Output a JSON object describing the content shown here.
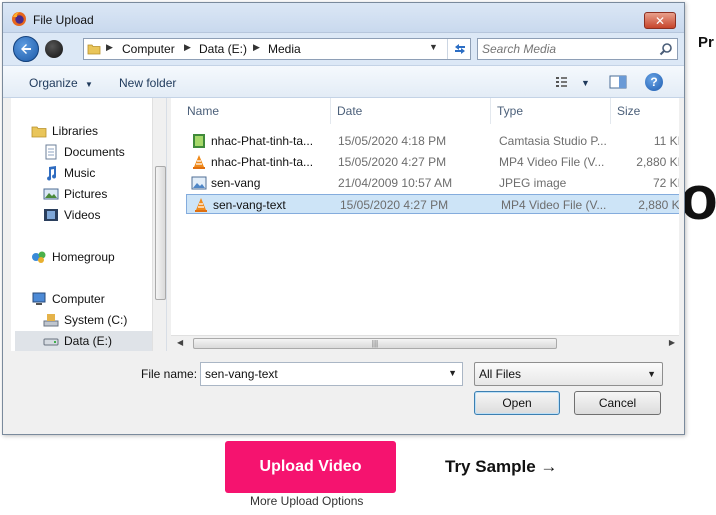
{
  "page": {
    "heading_fragment": "Pr",
    "big_text_fragment": "o",
    "upload_button": "Upload Video",
    "try_sample": "Try Sample →",
    "more_options": "More Upload Options"
  },
  "dialog": {
    "title": "File Upload",
    "close_label": "✕",
    "address": {
      "crumbs": [
        "Computer",
        "Data (E:)",
        "Media"
      ]
    },
    "search": {
      "placeholder": "Search Media"
    },
    "toolbar": {
      "organize": "Organize",
      "new_folder": "New folder",
      "help": "?"
    },
    "nav": {
      "items": [
        {
          "label": "Libraries",
          "icon": "libraries-icon"
        },
        {
          "label": "Documents",
          "icon": "documents-icon"
        },
        {
          "label": "Music",
          "icon": "music-icon"
        },
        {
          "label": "Pictures",
          "icon": "pictures-icon"
        },
        {
          "label": "Videos",
          "icon": "videos-icon"
        },
        {
          "label": "Homegroup",
          "icon": "homegroup-icon"
        },
        {
          "label": "Computer",
          "icon": "computer-icon"
        },
        {
          "label": "System (C:)",
          "icon": "drive-icon"
        },
        {
          "label": "Data (E:)",
          "icon": "drive-icon",
          "selected": true
        }
      ]
    },
    "columns": [
      "Name",
      "Date",
      "Type",
      "Size"
    ],
    "files": [
      {
        "name": "nhac-Phat-tinh-ta...",
        "date": "15/05/2020 4:18 PM",
        "type": "Camtasia Studio P...",
        "size": "11 KI",
        "icon": "camtasia-file-icon"
      },
      {
        "name": "nhac-Phat-tinh-ta...",
        "date": "15/05/2020 4:27 PM",
        "type": "MP4 Video File (V...",
        "size": "2,880 KI",
        "icon": "vlc-file-icon"
      },
      {
        "name": "sen-vang",
        "date": "21/04/2009 10:57 AM",
        "type": "JPEG image",
        "size": "72 KI",
        "icon": "image-file-icon"
      },
      {
        "name": "sen-vang-text",
        "date": "15/05/2020 4:27 PM",
        "type": "MP4 Video File (V...",
        "size": "2,880 KI",
        "icon": "vlc-file-icon",
        "selected": true
      }
    ],
    "file_name_label": "File name:",
    "file_name_value": "sen-vang-text",
    "file_type": "All Files",
    "open_button": "Open",
    "cancel_button": "Cancel"
  },
  "colors": {
    "upload_accent": "#f5136f",
    "selection": "#cde4f7",
    "close_red": "#c7452b"
  }
}
